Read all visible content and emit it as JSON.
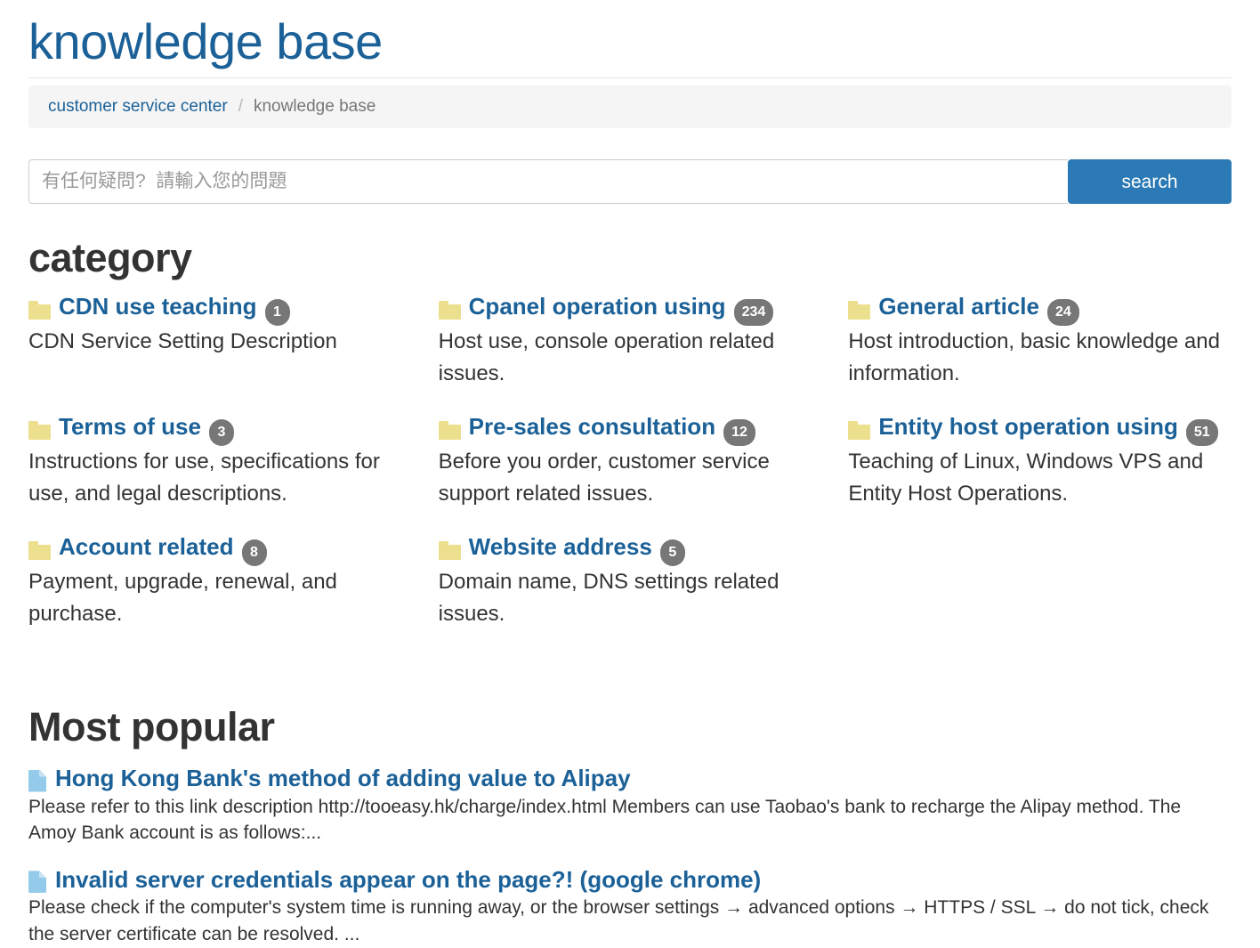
{
  "header": {
    "title": "knowledge base"
  },
  "breadcrumb": {
    "home_label": "customer service center",
    "separator": "/",
    "current_label": "knowledge base"
  },
  "search": {
    "placeholder": "有任何疑問?  請輸入您的問題",
    "value": "",
    "button_label": "search"
  },
  "sections": {
    "category_heading": "category",
    "popular_heading": "Most popular"
  },
  "categories": [
    {
      "title": "CDN use teaching",
      "count": "1",
      "description": "CDN Service Setting Description",
      "icon": "folder-icon"
    },
    {
      "title": "Cpanel operation using",
      "count": "234",
      "description": "Host use, console operation related issues.",
      "icon": "folder-icon"
    },
    {
      "title": "General article",
      "count": "24",
      "description": "Host introduction, basic knowledge and information.",
      "icon": "folder-icon"
    },
    {
      "title": "Terms of use",
      "count": "3",
      "description": "Instructions for use, specifications for use, and legal descriptions.",
      "icon": "folder-icon"
    },
    {
      "title": "Pre-sales consultation",
      "count": "12",
      "description": "Before you order, customer service support related issues.",
      "icon": "folder-icon"
    },
    {
      "title": "Entity host operation using",
      "count": "51",
      "description": "Teaching of Linux, Windows VPS and Entity Host Operations.",
      "icon": "folder-icon"
    },
    {
      "title": "Account related",
      "count": "8",
      "description": "Payment, upgrade, renewal, and purchase.",
      "icon": "folder-icon"
    },
    {
      "title": "Website address",
      "count": "5",
      "description": "Domain name, DNS settings related issues.",
      "icon": "folder-icon"
    }
  ],
  "popular_articles": [
    {
      "title": "Hong Kong Bank's method of adding value to Alipay",
      "excerpt": "Please refer to this link description http://tooeasy.hk/charge/index.html Members can use Taobao's bank to recharge the Alipay method. The Amoy Bank account is as follows:...",
      "icon": "document-icon"
    },
    {
      "title": "Invalid server credentials appear on the page?! (google chrome)",
      "excerpt": "Please check if the computer's system time is running away, or the browser settings → advanced options → HTTPS / SSL → do not tick, check the server certificate can be resolved. ...",
      "icon": "document-icon"
    }
  ],
  "colors": {
    "link": "#1b6198",
    "button": "#2b7ab5",
    "badge": "#777777",
    "folder": "#ecdf8d",
    "document": "#95cbea",
    "breadcrumb_bg": "#f5f5f5"
  }
}
